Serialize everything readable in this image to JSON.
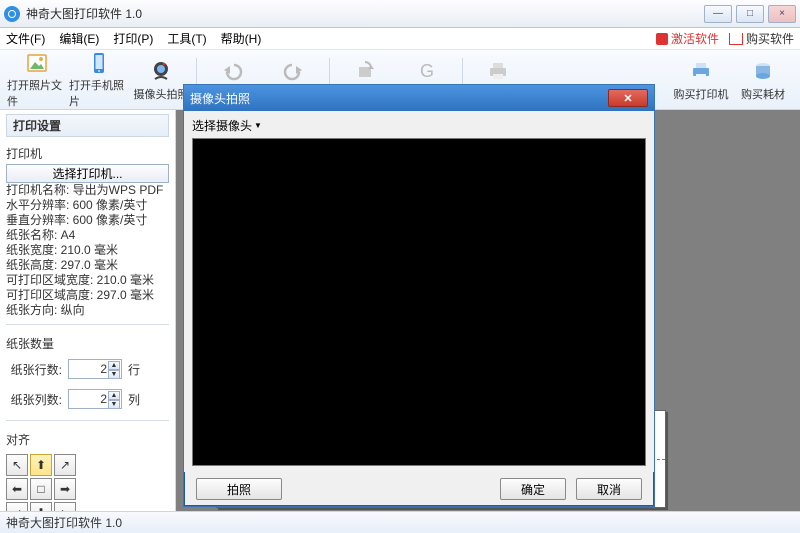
{
  "app": {
    "title": "神奇大图打印软件 1.0"
  },
  "window": {
    "min": "—",
    "max": "□",
    "close": "×"
  },
  "menu": {
    "file": "文件(F)",
    "edit": "编辑(E)",
    "print": "打印(P)",
    "tools": "工具(T)",
    "help": "帮助(H)",
    "activate": "激活软件",
    "buy": "购买软件"
  },
  "toolbar": {
    "open_file": "打开照片文件",
    "open_phone": "打开手机照片",
    "camera": "摄像头拍照",
    "undo": "撤销",
    "redo": "重做",
    "rotate": "照片旋转",
    "gray": "灰度化",
    "print_big": "打印大图",
    "buy_printer": "购买打印机",
    "buy_supply": "购买耗材"
  },
  "sidebar": {
    "panel_title": "打印设置",
    "printer_head": "打印机",
    "choose_printer": "选择打印机...",
    "lines": [
      "打印机名称:  导出为WPS PDF",
      "水平分辨率:  600 像素/英寸",
      "垂直分辨率:  600 像素/英寸",
      "纸张名称:  A4",
      "纸张宽度:  210.0 毫米",
      "纸张高度:  297.0 毫米",
      "可打印区域宽度:  210.0 毫米",
      "可打印区域高度:  297.0 毫米",
      "纸张方向:  纵向"
    ],
    "count_head": "纸张数量",
    "rows_label": "纸张行数:",
    "rows_value": "2",
    "rows_suffix": "行",
    "cols_label": "纸张列数:",
    "cols_value": "2",
    "cols_suffix": "列",
    "align_head": "对齐"
  },
  "dialog": {
    "title": "摄像头拍照",
    "select_camera": "选择摄像头",
    "shoot": "拍照",
    "ok": "确定",
    "cancel": "取消"
  },
  "status": {
    "text": "神奇大图打印软件 1.0"
  },
  "colors": {
    "accent": "#2f73c0",
    "danger": "#c83b2c"
  }
}
